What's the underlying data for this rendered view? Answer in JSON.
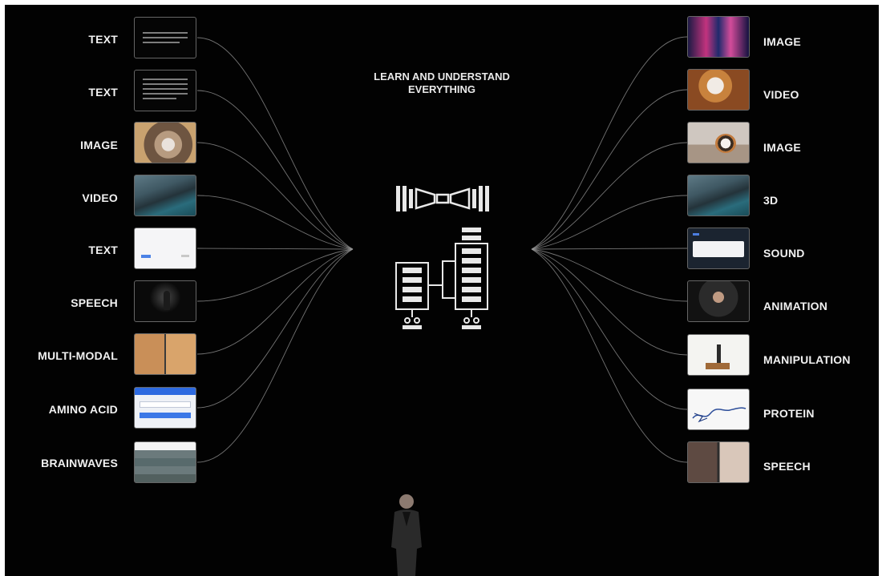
{
  "center_title": {
    "line1": "LEARN AND UNDERSTAND",
    "line2": "EVERYTHING"
  },
  "inputs": [
    {
      "label": "TEXT",
      "thumb": "text-prompt"
    },
    {
      "label": "TEXT",
      "thumb": "text-paragraph"
    },
    {
      "label": "IMAGE",
      "thumb": "cat-photo"
    },
    {
      "label": "VIDEO",
      "thumb": "coastline-video"
    },
    {
      "label": "TEXT",
      "thumb": "web-form"
    },
    {
      "label": "SPEECH",
      "thumb": "stage-speaker"
    },
    {
      "label": "MULTI-MODAL",
      "thumb": "robot-arm"
    },
    {
      "label": "AMINO ACID",
      "thumb": "protein-sequence-form"
    },
    {
      "label": "BRAINWAVES",
      "thumb": "brainwave-waveform"
    }
  ],
  "outputs": [
    {
      "label": "IMAGE",
      "thumb": "neon-city-cat"
    },
    {
      "label": "VIDEO",
      "thumb": "cat-robot"
    },
    {
      "label": "IMAGE",
      "thumb": "kitten-photo"
    },
    {
      "label": "3D",
      "thumb": "coastline-3d"
    },
    {
      "label": "SOUND",
      "thumb": "audio-ui"
    },
    {
      "label": "ANIMATION",
      "thumb": "talking-head"
    },
    {
      "label": "MANIPULATION",
      "thumb": "robot-table"
    },
    {
      "label": "PROTEIN",
      "thumb": "protein-structure"
    },
    {
      "label": "SPEECH",
      "thumb": "video-call"
    }
  ],
  "colors": {
    "background": "#020202",
    "wire": "#9a9a9a",
    "icon": "#e8e8e8",
    "label": "#f1f1f1"
  }
}
